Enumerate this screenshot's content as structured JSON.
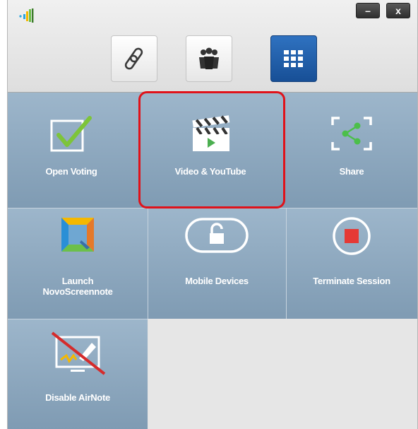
{
  "window": {
    "minimize_label": "–",
    "close_label": "x"
  },
  "modes": [
    {
      "name": "link-icon",
      "active": false
    },
    {
      "name": "group-icon",
      "active": false
    },
    {
      "name": "apps-grid-icon",
      "active": true
    }
  ],
  "tiles": {
    "open_voting": "Open Voting",
    "video_youtube": "Video & YouTube",
    "share": "Share",
    "launch_screennote_line1": "Launch",
    "launch_screennote_line2": "NovoScreennote",
    "mobile_devices": "Mobile Devices",
    "terminate_session": "Terminate Session",
    "disable_airnote": "Disable AirNote"
  },
  "colors": {
    "tile": "#8ea9c0",
    "active_mode": "#1f5eab",
    "highlight": "#e0121a",
    "check": "#7dc43a",
    "stop": "#e53935"
  }
}
